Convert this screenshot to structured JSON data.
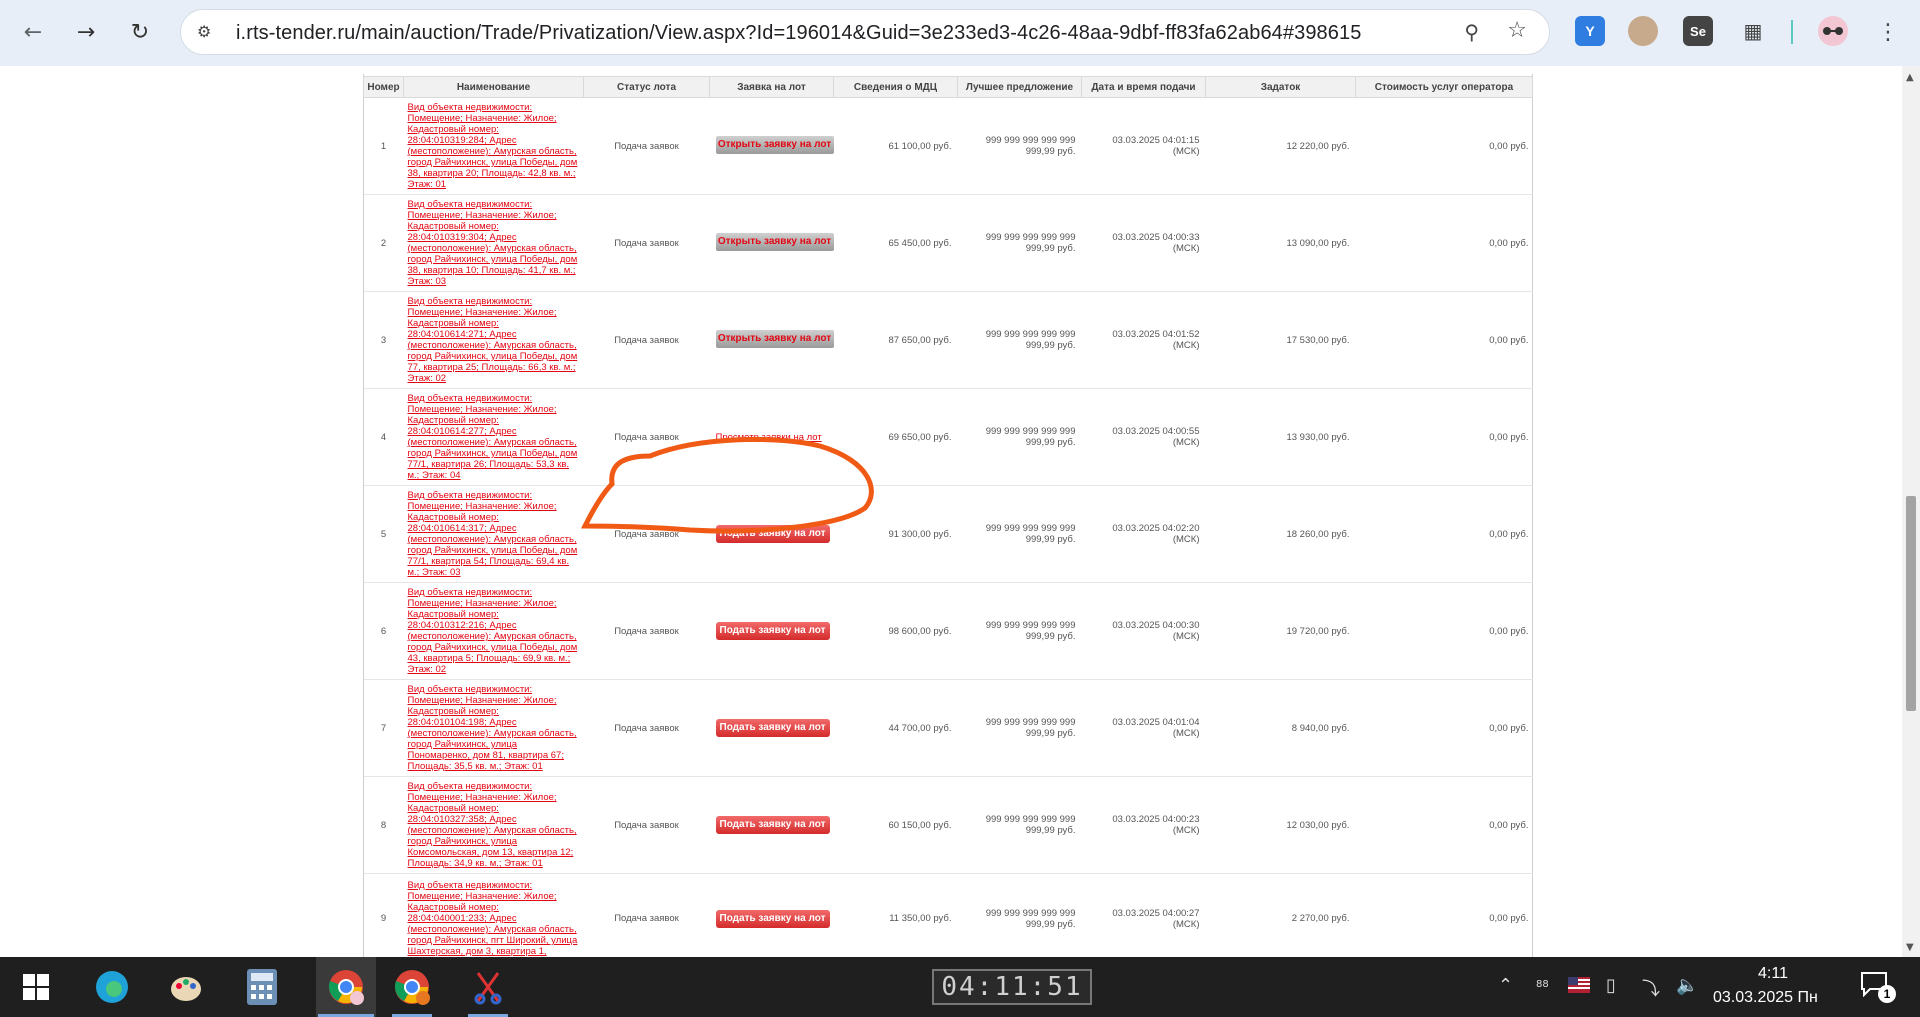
{
  "browser": {
    "url": "i.rts-tender.ru/main/auction/Trade/Privatization/View.aspx?Id=196014&Guid=3e233ed3-4c26-48aa-9dbf-ff83fa62ab64#398615",
    "extensions": [
      "yandex-icon",
      "agent-icon",
      "selenium-icon",
      "puzzle-icon",
      "profile-glasses-icon"
    ],
    "ext_selenium_label": "Se"
  },
  "table": {
    "headers": [
      "Номер",
      "Наименование",
      "Статус лота",
      "Заявка на лот",
      "Сведения о МДЦ",
      "Лучшее предложение",
      "Дата и время подачи",
      "Задаток",
      "Стоимость услуг оператора"
    ],
    "rows": [
      {
        "num": "1",
        "name": "Вид объекта недвижимости: Помещение; Назначение: Жилое; Кадастровый номер: 28:04:010319:284; Адрес (местоположение): Амурская область, город Райчихинск, улица Победы, дом 38, квартира 20; Площадь: 42,8 кв. м.; Этаж: 01",
        "status": "Подача заявок",
        "action": "Открыть заявку на лот",
        "action_type": "open",
        "mdc": "61 100,00 руб.",
        "best_1": "999 999 999 999 999",
        "best_2": "999,99 руб.",
        "date_1": "03.03.2025 04:01:15",
        "date_2": "(МСК)",
        "deposit": "12 220,00 руб.",
        "fee": "0,00 руб."
      },
      {
        "num": "2",
        "name": "Вид объекта недвижимости: Помещение; Назначение: Жилое; Кадастровый номер: 28:04:010319:304; Адрес (местоположение): Амурская область, город Райчихинск, улица Победы, дом 38, квартира 10; Площадь: 41,7 кв. м.; Этаж: 03",
        "status": "Подача заявок",
        "action": "Открыть заявку на лот",
        "action_type": "open",
        "mdc": "65 450,00 руб.",
        "best_1": "999 999 999 999 999",
        "best_2": "999,99 руб.",
        "date_1": "03.03.2025 04:00:33",
        "date_2": "(МСК)",
        "deposit": "13 090,00 руб.",
        "fee": "0,00 руб."
      },
      {
        "num": "3",
        "name": "Вид объекта недвижимости: Помещение; Назначение: Жилое; Кадастровый номер: 28:04:010614:271; Адрес (местоположение): Амурская область, город Райчихинск, улица Победы, дом 77, квартира 25; Площадь: 66,3 кв. м.; Этаж: 02",
        "status": "Подача заявок",
        "action": "Открыть заявку на лот",
        "action_type": "open",
        "mdc": "87 650,00 руб.",
        "best_1": "999 999 999 999 999",
        "best_2": "999,99 руб.",
        "date_1": "03.03.2025 04:01:52",
        "date_2": "(МСК)",
        "deposit": "17 530,00 руб.",
        "fee": "0,00 руб."
      },
      {
        "num": "4",
        "name": "Вид объекта недвижимости: Помещение; Назначение: Жилое; Кадастровый номер: 28:04:010614:277; Адрес (местоположение): Амурская область, город Райчихинск, улица Победы, дом 77/1, квартира 26; Площадь: 53,3 кв. м.; Этаж: 04",
        "status": "Подача заявок",
        "action": "Просмотр заявки на лот",
        "action_type": "view",
        "mdc": "69 650,00 руб.",
        "best_1": "999 999 999 999 999",
        "best_2": "999,99 руб.",
        "date_1": "03.03.2025 04:00:55",
        "date_2": "(МСК)",
        "deposit": "13 930,00 руб.",
        "fee": "0,00 руб."
      },
      {
        "num": "5",
        "name": "Вид объекта недвижимости: Помещение; Назначение: Жилое; Кадастровый номер: 28:04:010614:317; Адрес (местоположение): Амурская область, город Райчихинск, улица Победы, дом 77/1, квартира 54; Площадь: 69,4 кв. м.; Этаж: 03",
        "status": "Подача заявок",
        "action": "Подать заявку на лот",
        "action_type": "submit",
        "mdc": "91 300,00 руб.",
        "best_1": "999 999 999 999 999",
        "best_2": "999,99 руб.",
        "date_1": "03.03.2025 04:02:20",
        "date_2": "(МСК)",
        "deposit": "18 260,00 руб.",
        "fee": "0,00 руб."
      },
      {
        "num": "6",
        "name": "Вид объекта недвижимости: Помещение; Назначение: Жилое; Кадастровый номер: 28:04:010312:216; Адрес (местоположение): Амурская область, город Райчихинск, улица Победы, дом 43, квартира 5; Площадь: 69,9 кв. м.; Этаж: 02",
        "status": "Подача заявок",
        "action": "Подать заявку на лот",
        "action_type": "submit",
        "mdc": "98 600,00 руб.",
        "best_1": "999 999 999 999 999",
        "best_2": "999,99 руб.",
        "date_1": "03.03.2025 04:00:30",
        "date_2": "(МСК)",
        "deposit": "19 720,00 руб.",
        "fee": "0,00 руб."
      },
      {
        "num": "7",
        "name": "Вид объекта недвижимости: Помещение; Назначение: Жилое; Кадастровый номер: 28:04:010104:198; Адрес (местоположение): Амурская область, город Райчихинск, улица Пономаренко, дом 81, квартира 67; Площадь: 35,5 кв. м.; Этаж: 01",
        "status": "Подача заявок",
        "action": "Подать заявку на лот",
        "action_type": "submit",
        "mdc": "44 700,00 руб.",
        "best_1": "999 999 999 999 999",
        "best_2": "999,99 руб.",
        "date_1": "03.03.2025 04:01:04",
        "date_2": "(МСК)",
        "deposit": "8 940,00 руб.",
        "fee": "0,00 руб."
      },
      {
        "num": "8",
        "name": "Вид объекта недвижимости: Помещение; Назначение: Жилое; Кадастровый номер: 28:04:010327:358; Адрес (местоположение): Амурская область, город Райчихинск, улица Комсомольская, дом 13, квартира 12; Площадь: 34,9 кв. м.; Этаж: 01",
        "status": "Подача заявок",
        "action": "Подать заявку на лот",
        "action_type": "submit",
        "mdc": "60 150,00 руб.",
        "best_1": "999 999 999 999 999",
        "best_2": "999,99 руб.",
        "date_1": "03.03.2025 04:00:23",
        "date_2": "(МСК)",
        "deposit": "12 030,00 руб.",
        "fee": "0,00 руб."
      },
      {
        "num": "9",
        "name": "Вид объекта недвижимости: Помещение; Назначение: Жилое; Кадастровый номер: 28:04:040001:233; Адрес (местоположение): Амурская область, город Райчихинск, пгт Широкий, улица Шахтерская, дом 3, квартира 1,",
        "status": "Подача заявок",
        "action": "Подать заявку на лот",
        "action_type": "submit",
        "mdc": "11 350,00 руб.",
        "best_1": "999 999 999 999 999",
        "best_2": "999,99 руб.",
        "date_1": "03.03.2025 04:00:27",
        "date_2": "(МСК)",
        "deposit": "2 270,00 руб.",
        "fee": "0,00 руб."
      }
    ]
  },
  "taskbar": {
    "clock_widget": "04:11:51",
    "tray_number": "88",
    "time": "4:11",
    "date": "03.03.2025 Пн",
    "notification_count": "1"
  },
  "colors": {
    "accent_red": "#e30613",
    "annotation_orange": "#f05a14"
  }
}
